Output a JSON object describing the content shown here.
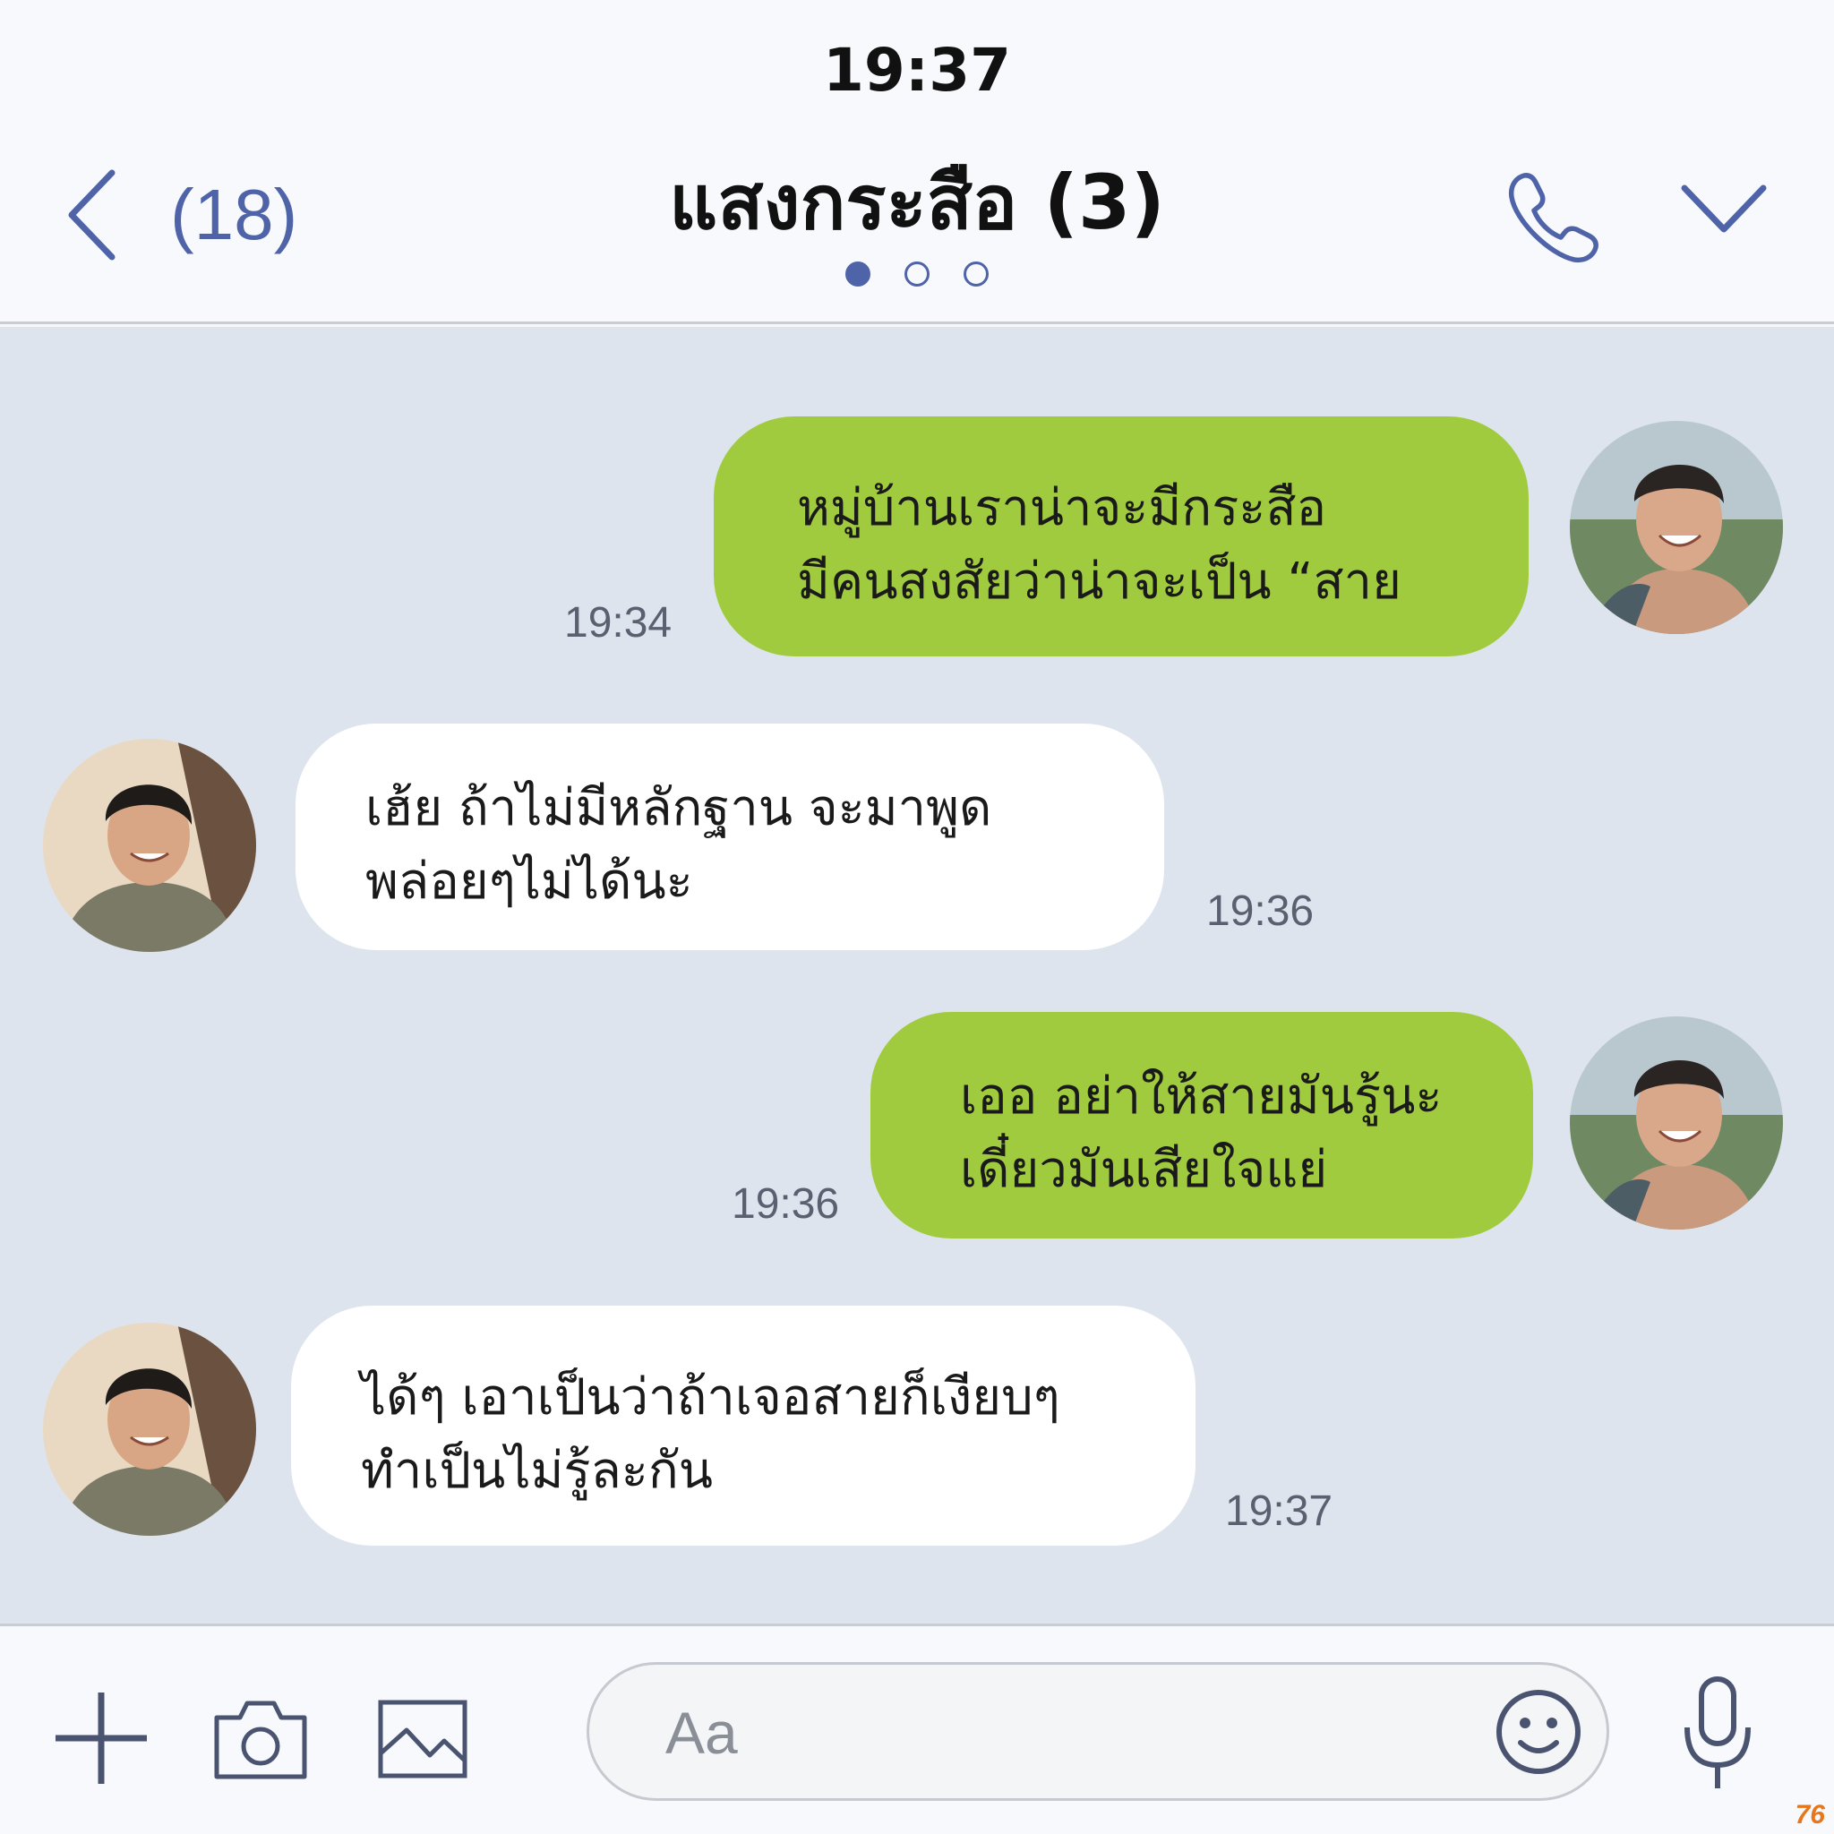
{
  "status_bar": {
    "time": "19:37"
  },
  "header": {
    "unread_count": "(18)",
    "title": "แสงกระสือ (3)",
    "page_indicator": {
      "total": 3,
      "active": 1
    }
  },
  "messages": [
    {
      "sender": "me",
      "lines": [
        "หมู่บ้านเราน่าจะมีกระสือ",
        "มีคนสงสัยว่าน่าจะเป็น “สาย"
      ],
      "time": "19:34"
    },
    {
      "sender": "them",
      "lines": [
        "เฮ้ย ถ้าไม่มีหลักฐาน จะมาพูด",
        "พล่อยๆไม่ได้นะ"
      ],
      "time": "19:36"
    },
    {
      "sender": "me",
      "lines": [
        "เออ อย่าให้สายมันรู้นะ",
        "เดี๋ยวมันเสียใจแย่"
      ],
      "time": "19:36"
    },
    {
      "sender": "them",
      "lines": [
        "ได้ๆ เอาเป็นว่าถ้าเจอสายก็เงียบๆ",
        "ทำเป็นไม่รู้ละกัน"
      ],
      "time": "19:37"
    }
  ],
  "input_bar": {
    "placeholder": "Aa"
  },
  "watermark": "76",
  "colors": {
    "accent": "#4f64a8",
    "my_bubble": "#a0cb3e",
    "their_bubble": "#ffffff",
    "chat_background": "#dde4ee"
  },
  "icons": [
    "chevron-left-icon",
    "phone-icon",
    "chevron-down-icon",
    "plus-icon",
    "camera-icon",
    "image-icon",
    "smiley-icon",
    "microphone-icon"
  ]
}
